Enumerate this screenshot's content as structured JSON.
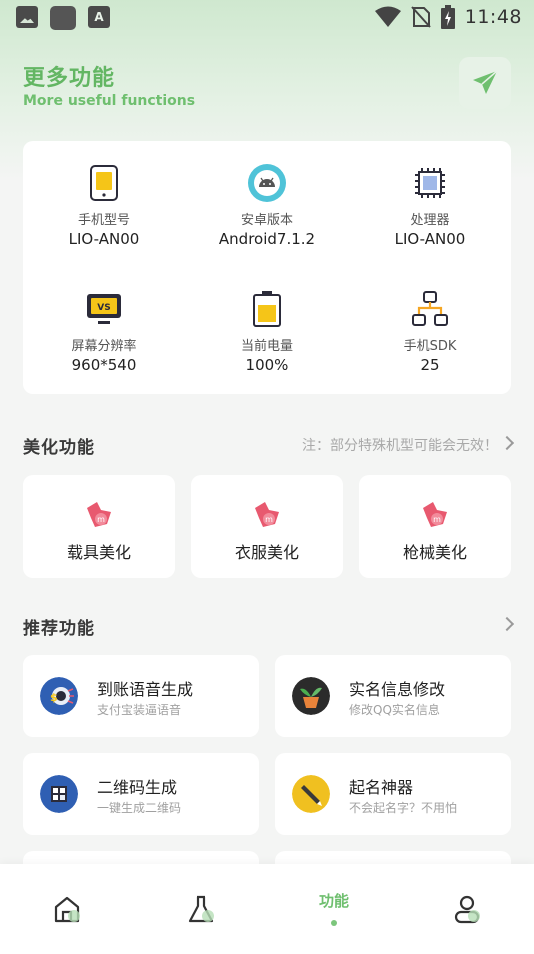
{
  "status_bar": {
    "time": "11:48",
    "left_icons": [
      "image-icon",
      "app-icon",
      "text-icon"
    ],
    "text_icon_letter": "A",
    "right_icons": [
      "wifi-icon",
      "no-sim-icon",
      "battery-charging-icon"
    ]
  },
  "header": {
    "title": "更多功能",
    "subtitle": "More useful functions",
    "action_icon": "send-icon"
  },
  "device_info": {
    "items": [
      {
        "label": "手机型号",
        "value": "LIO-AN00",
        "icon": "phone-icon"
      },
      {
        "label": "安卓版本",
        "value": "Android7.1.2",
        "icon": "android-icon"
      },
      {
        "label": "处理器",
        "value": "LIO-AN00",
        "icon": "cpu-icon"
      },
      {
        "label": "屏幕分辨率",
        "value": "960*540",
        "icon": "monitor-icon"
      },
      {
        "label": "当前电量",
        "value": "100%",
        "icon": "battery-icon"
      },
      {
        "label": "手机SDK",
        "value": "25",
        "icon": "network-icon"
      }
    ]
  },
  "beautify": {
    "title": "美化功能",
    "note": "注：部分特殊机型可能会无效！",
    "items": [
      {
        "label": "载具美化",
        "icon": "skin-icon"
      },
      {
        "label": "衣服美化",
        "icon": "skin-icon"
      },
      {
        "label": "枪械美化",
        "icon": "skin-icon"
      }
    ]
  },
  "recommended": {
    "title": "推荐功能",
    "items": [
      {
        "title": "到账语音生成",
        "subtitle": "支付宝装逼语音",
        "icon": "payment-voice-icon"
      },
      {
        "title": "实名信息修改",
        "subtitle": "修改QQ实名信息",
        "icon": "plant-pot-icon"
      },
      {
        "title": "二维码生成",
        "subtitle": "一键生成二维码",
        "icon": "qr-code-icon"
      },
      {
        "title": "起名神器",
        "subtitle": "不会起名字？不用怕",
        "icon": "pen-icon"
      }
    ]
  },
  "bottom_nav": {
    "active_label": "功能",
    "items": [
      "home-icon",
      "flask-icon",
      "functions-tab",
      "user-icon"
    ]
  },
  "colors": {
    "accent": "#63b663",
    "background": "#f4f5f4",
    "card": "#ffffff",
    "beautify_icon": "#e8596f"
  }
}
